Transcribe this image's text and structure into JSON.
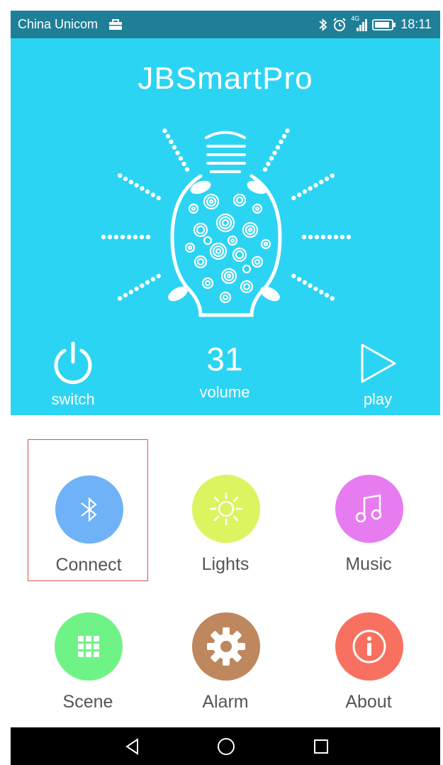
{
  "status_bar": {
    "carrier": "China Unicom",
    "network": "4G",
    "time": "18:11"
  },
  "app": {
    "title": "JBSmartPro"
  },
  "controls": {
    "switch_label": "switch",
    "volume_value": "31",
    "volume_label": "volume",
    "play_label": "play"
  },
  "menu": {
    "items": [
      {
        "label": "Connect",
        "icon": "bluetooth-icon",
        "color": "#6fb2f7"
      },
      {
        "label": "Lights",
        "icon": "sun-icon",
        "color": "#ddf461"
      },
      {
        "label": "Music",
        "icon": "music-note-icon",
        "color": "#e77cf0"
      },
      {
        "label": "Scene",
        "icon": "grid-icon",
        "color": "#6ff387"
      },
      {
        "label": "Alarm",
        "icon": "gear-icon",
        "color": "#be875d"
      },
      {
        "label": "About",
        "icon": "info-icon",
        "color": "#f8705f"
      }
    ],
    "selected_index": 0
  },
  "colors": {
    "status_bar": "#1f7f97",
    "hero": "#2cd4f3",
    "selection_border": "#d9534f",
    "nav_bar": "#000000"
  }
}
